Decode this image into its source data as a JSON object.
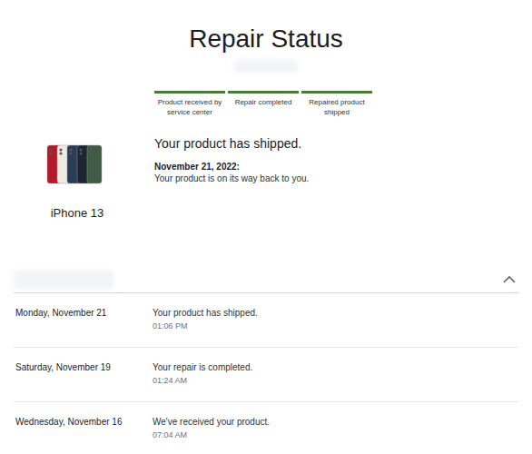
{
  "page": {
    "title": "Repair Status"
  },
  "progress": [
    {
      "label": "Product received by service center",
      "completed": true
    },
    {
      "label": "Repair completed",
      "completed": true
    },
    {
      "label": "Repaired product shipped",
      "completed": true
    }
  ],
  "product": {
    "name": "iPhone 13",
    "colors": [
      "#b3192b",
      "#eeebe4",
      "#2a3d55",
      "#1c2530",
      "#3f5a45"
    ]
  },
  "status": {
    "heading": "Your product has shipped.",
    "date": "November 21, 2022:",
    "message": "Your product is on its way back to you."
  },
  "history": {
    "expanded": true,
    "events": [
      {
        "date": "Monday, November 21",
        "message": "Your product has shipped.",
        "time": "01:06 PM"
      },
      {
        "date": "Saturday, November 19",
        "message": "Your repair is completed.",
        "time": "01:24 AM"
      },
      {
        "date": "Wednesday, November 16",
        "message": "We've received your product.",
        "time": "07:04 AM"
      }
    ]
  }
}
